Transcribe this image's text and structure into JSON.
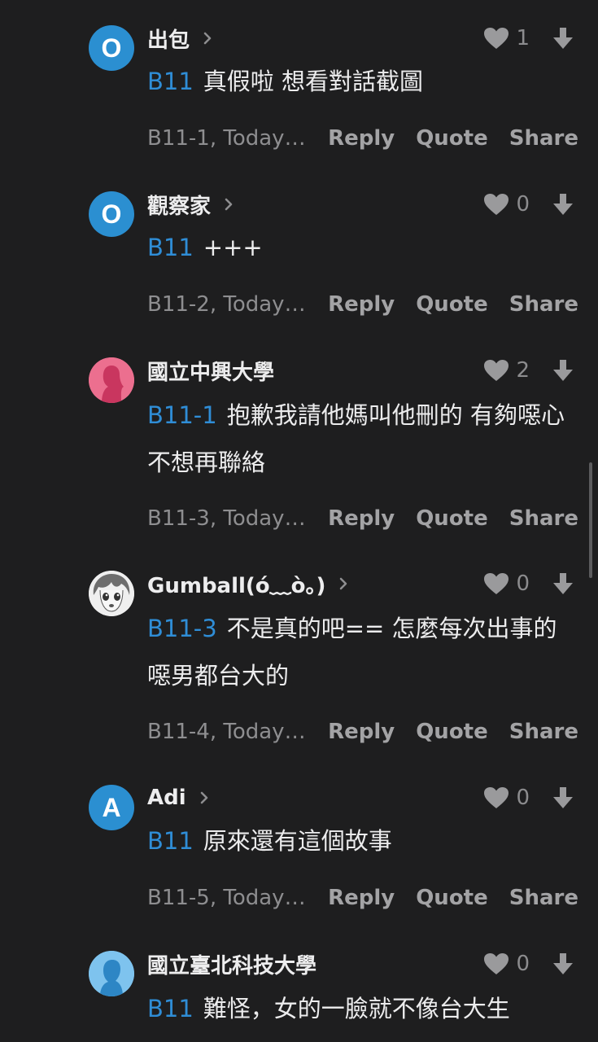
{
  "comments": [
    {
      "name": "出包",
      "avatar_letter": "O",
      "likes": "1",
      "ref": "B11",
      "text": "真假啦 想看對話截圖",
      "meta": "B11-1, Today…",
      "reply": "Reply",
      "quote": "Quote",
      "share": "Share"
    },
    {
      "name": "觀察家",
      "avatar_letter": "O",
      "likes": "0",
      "ref": "B11",
      "text": "+++",
      "meta": "B11-2, Today…",
      "reply": "Reply",
      "quote": "Quote",
      "share": "Share"
    },
    {
      "name": "國立中興大學",
      "likes": "2",
      "ref": "B11-1",
      "text": "抱歉我請他媽叫他刪的 有夠噁心 不想再聯絡",
      "meta": "B11-3, Today…",
      "reply": "Reply",
      "quote": "Quote",
      "share": "Share"
    },
    {
      "name": "Gumball(ó﹏ò。)",
      "likes": "0",
      "ref": "B11-3",
      "text": "不是真的吧== 怎麼每次出事的噁男都台大的",
      "meta": "B11-4, Today…",
      "reply": "Reply",
      "quote": "Quote",
      "share": "Share"
    },
    {
      "name": "Adi",
      "avatar_letter": "A",
      "likes": "0",
      "ref": "B11",
      "text": "原來還有這個故事",
      "meta": "B11-5, Today…",
      "reply": "Reply",
      "quote": "Quote",
      "share": "Share"
    },
    {
      "name": "國立臺北科技大學",
      "likes": "0",
      "ref": "B11",
      "text": "難怪，女的一臉就不像台大生"
    }
  ],
  "colors": {
    "background": "#1e1e1f",
    "accent": "#2f8dd6",
    "muted": "#8e8e90"
  },
  "icons": {
    "chevron": "chevron-right-icon",
    "like": "heart-icon",
    "dislike": "downvote-arrow-icon"
  }
}
